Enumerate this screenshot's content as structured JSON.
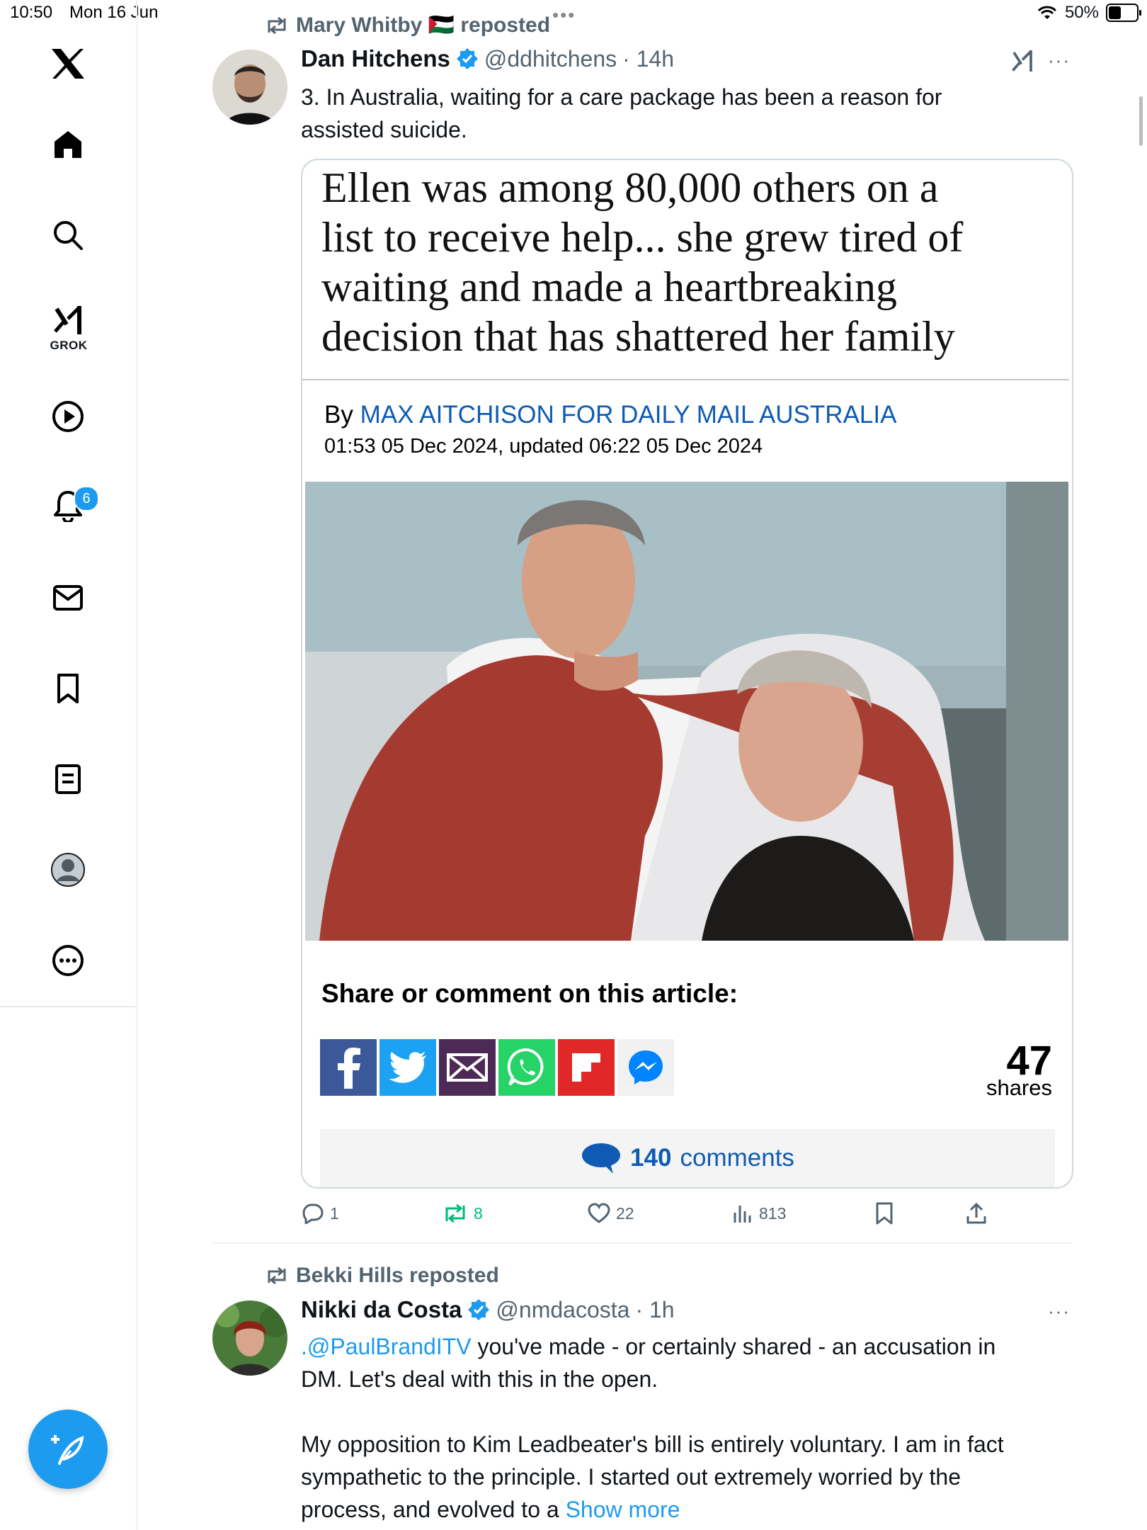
{
  "status_bar": {
    "time": "10:50",
    "date": "Mon 16 Jun",
    "battery": "50%",
    "battery_level": 0.5
  },
  "sidebar": {
    "items": [
      {
        "icon": "x-logo-icon"
      },
      {
        "icon": "home-icon"
      },
      {
        "icon": "search-icon"
      },
      {
        "icon": "grok-icon",
        "label": "GROK"
      },
      {
        "icon": "play-icon"
      },
      {
        "icon": "bell-icon",
        "badge": "6"
      },
      {
        "icon": "mail-icon"
      },
      {
        "icon": "bookmark-icon"
      },
      {
        "icon": "list-icon"
      },
      {
        "icon": "profile-icon"
      },
      {
        "icon": "more-icon"
      }
    ],
    "compose_icon": "compose-feather-icon"
  },
  "tweets": [
    {
      "repost": {
        "text": "Mary Whitby 🇵🇸 reposted"
      },
      "author": {
        "name": "Dan Hitchens",
        "handle": "@ddhitchens",
        "time": "· 14h"
      },
      "text_lines": [
        "3. In Australia, waiting for a care package has been a reason for",
        "assisted suicide."
      ],
      "card": {
        "headline": [
          "Ellen was among 80,000 others on a",
          "list to receive help... she grew tired of",
          "waiting and made a heartbreaking",
          "decision that has shattered her family"
        ],
        "by": "By",
        "author": "MAX AITCHISON FOR DAILY MAIL AUSTRALIA",
        "date": "01:53 05 Dec 2024, updated 06:22 05 Dec 2024",
        "share_title": "Share or comment on this article:",
        "share_count": "47",
        "share_label": "shares",
        "comments_count": "140",
        "comments_label": "comments"
      },
      "actions": {
        "replies": "1",
        "reposts": "8",
        "likes": "22",
        "views": "813"
      }
    },
    {
      "repost": {
        "text": "Bekki Hills reposted"
      },
      "author": {
        "name": "Nikki da Costa",
        "handle": "@nmdacosta",
        "time": "· 1h"
      },
      "mention": ".@PaulBrandITV",
      "text_lines": [
        " you've made - or certainly shared - an accusation in",
        "DM. Let's deal with this in the open.",
        "My opposition to Kim Leadbeater's bill is entirely voluntary. I am in fact",
        "sympathetic to the principle. I started out extremely worried by the",
        "process, and evolved to a "
      ],
      "show_more": "Show more"
    }
  ],
  "colors": {
    "accent": "#1d9bf0",
    "secondary_text": "#536471",
    "repost_green": "#00ba7c",
    "dm_blue": "#0f5bb3"
  }
}
